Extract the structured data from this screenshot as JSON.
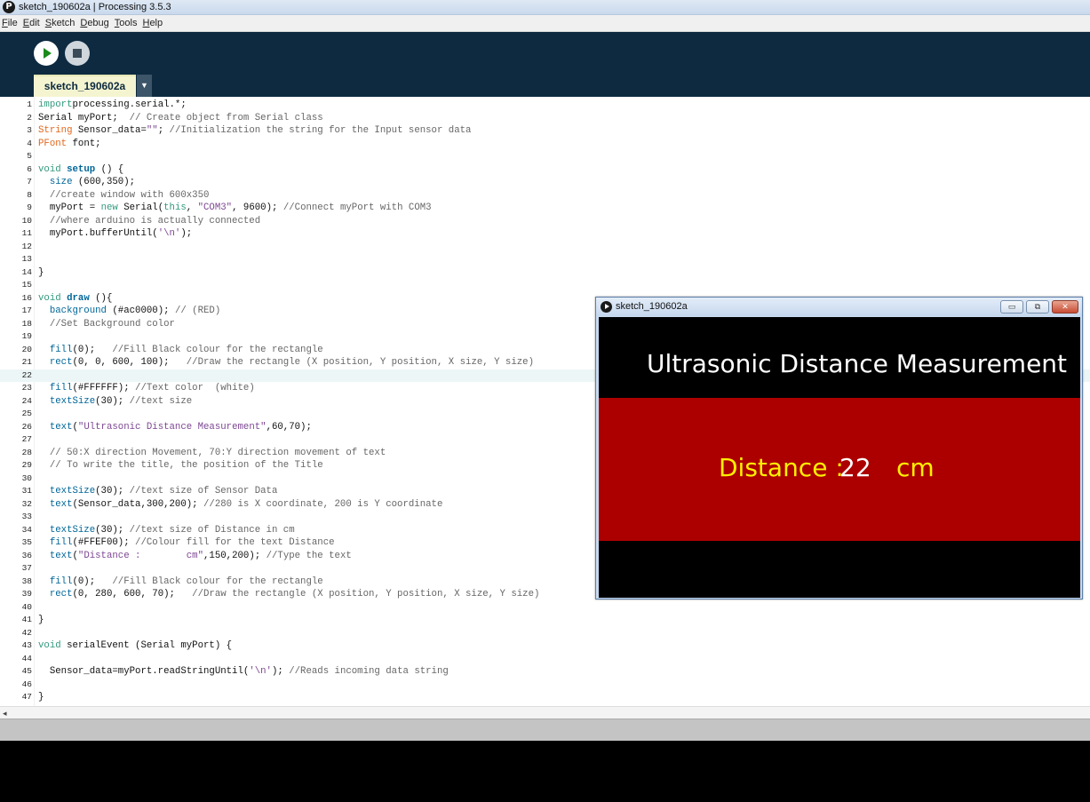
{
  "window": {
    "title": "sketch_190602a | Processing 3.5.3",
    "app_icon": "processing-logo-icon"
  },
  "menu": [
    {
      "mnemonic": "F",
      "rest": "ile"
    },
    {
      "mnemonic": "E",
      "rest": "dit"
    },
    {
      "mnemonic": "S",
      "rest": "ketch"
    },
    {
      "mnemonic": "D",
      "rest": "ebug"
    },
    {
      "mnemonic": "T",
      "rest": "ools"
    },
    {
      "mnemonic": "H",
      "rest": "elp"
    }
  ],
  "toolbar": {
    "run_icon": "play-icon",
    "stop_icon": "stop-icon"
  },
  "tabs": {
    "active": "sketch_190602a",
    "menu_glyph": "▼"
  },
  "editor": {
    "current_line": 22,
    "lines": [
      [
        [
          "kw",
          "import"
        ],
        [
          "",
          "processing.serial.*;"
        ]
      ],
      [
        [
          "",
          "Serial myPort;  "
        ],
        [
          "cm",
          "// Create object from Serial class"
        ]
      ],
      [
        [
          "ty",
          "String"
        ],
        [
          "",
          " Sensor_data="
        ],
        [
          "st",
          "\"\""
        ],
        [
          "",
          "; "
        ],
        [
          "cm",
          "//Initialization the string for the Input sensor data"
        ]
      ],
      [
        [
          "ty",
          "PFont"
        ],
        [
          "",
          " font;"
        ]
      ],
      [],
      [
        [
          "kw",
          "void"
        ],
        [
          "",
          " "
        ],
        [
          "fn",
          "setup"
        ],
        [
          "",
          " () {"
        ]
      ],
      [
        [
          "",
          "  "
        ],
        [
          "bi",
          "size"
        ],
        [
          "",
          " (600,350);"
        ]
      ],
      [
        [
          "",
          "  "
        ],
        [
          "cm",
          "//create window with 600x350"
        ]
      ],
      [
        [
          "",
          "  myPort = "
        ],
        [
          "kw",
          "new"
        ],
        [
          "",
          " Serial("
        ],
        [
          "kw",
          "this"
        ],
        [
          "",
          ", "
        ],
        [
          "st",
          "\"COM3\""
        ],
        [
          "",
          ", 9600); "
        ],
        [
          "cm",
          "//Connect myPort with COM3"
        ]
      ],
      [
        [
          "",
          "  "
        ],
        [
          "cm",
          "//where arduino is actually connected"
        ]
      ],
      [
        [
          "",
          "  myPort.bufferUntil("
        ],
        [
          "st",
          "'\\n'"
        ],
        [
          "",
          ");"
        ]
      ],
      [],
      [],
      [
        [
          "",
          "}"
        ]
      ],
      [],
      [
        [
          "kw",
          "void"
        ],
        [
          "",
          " "
        ],
        [
          "fn",
          "draw"
        ],
        [
          "",
          " (){"
        ]
      ],
      [
        [
          "",
          "  "
        ],
        [
          "bi",
          "background"
        ],
        [
          "",
          " (#ac0000); "
        ],
        [
          "cm",
          "// (RED)"
        ]
      ],
      [
        [
          "",
          "  "
        ],
        [
          "cm",
          "//Set Background color"
        ]
      ],
      [],
      [
        [
          "",
          "  "
        ],
        [
          "bi",
          "fill"
        ],
        [
          "",
          "(0);   "
        ],
        [
          "cm",
          "//Fill Black colour for the rectangle"
        ]
      ],
      [
        [
          "",
          "  "
        ],
        [
          "bi",
          "rect"
        ],
        [
          "",
          "(0, 0, 600, 100);   "
        ],
        [
          "cm",
          "//Draw the rectangle (X position, Y position, X size, Y size)"
        ]
      ],
      [],
      [
        [
          "",
          "  "
        ],
        [
          "bi",
          "fill"
        ],
        [
          "",
          "(#FFFFFF); "
        ],
        [
          "cm",
          "//Text color  (white)"
        ]
      ],
      [
        [
          "",
          "  "
        ],
        [
          "bi",
          "textSize"
        ],
        [
          "",
          "(30); "
        ],
        [
          "cm",
          "//text size"
        ]
      ],
      [],
      [
        [
          "",
          "  "
        ],
        [
          "bi",
          "text"
        ],
        [
          "",
          "("
        ],
        [
          "st",
          "\"Ultrasonic Distance Measurement\""
        ],
        [
          "",
          ",60,70);"
        ]
      ],
      [],
      [
        [
          "",
          "  "
        ],
        [
          "cm",
          "// 50:X direction Movement, 70:Y direction movement of text"
        ]
      ],
      [
        [
          "",
          "  "
        ],
        [
          "cm",
          "// To write the title, the position of the Title"
        ]
      ],
      [],
      [
        [
          "",
          "  "
        ],
        [
          "bi",
          "textSize"
        ],
        [
          "",
          "(30); "
        ],
        [
          "cm",
          "//text size of Sensor Data"
        ]
      ],
      [
        [
          "",
          "  "
        ],
        [
          "bi",
          "text"
        ],
        [
          "",
          "(Sensor_data,300,200); "
        ],
        [
          "cm",
          "//280 is X coordinate, 200 is Y coordinate"
        ]
      ],
      [],
      [
        [
          "",
          "  "
        ],
        [
          "bi",
          "textSize"
        ],
        [
          "",
          "(30); "
        ],
        [
          "cm",
          "//text size of Distance in cm"
        ]
      ],
      [
        [
          "",
          "  "
        ],
        [
          "bi",
          "fill"
        ],
        [
          "",
          "(#FFEF00); "
        ],
        [
          "cm",
          "//Colour fill for the text Distance"
        ]
      ],
      [
        [
          "",
          "  "
        ],
        [
          "bi",
          "text"
        ],
        [
          "",
          "("
        ],
        [
          "st",
          "\"Distance :        cm\""
        ],
        [
          "",
          ",150,200); "
        ],
        [
          "cm",
          "//Type the text"
        ]
      ],
      [],
      [
        [
          "",
          "  "
        ],
        [
          "bi",
          "fill"
        ],
        [
          "",
          "(0);   "
        ],
        [
          "cm",
          "//Fill Black colour for the rectangle"
        ]
      ],
      [
        [
          "",
          "  "
        ],
        [
          "bi",
          "rect"
        ],
        [
          "",
          "(0, 280, 600, 70);   "
        ],
        [
          "cm",
          "//Draw the rectangle (X position, Y position, X size, Y size)"
        ]
      ],
      [],
      [
        [
          "",
          "}"
        ]
      ],
      [],
      [
        [
          "kw",
          "void"
        ],
        [
          "",
          " serialEvent (Serial myPort) {"
        ]
      ],
      [],
      [
        [
          "",
          "  Sensor_data=myPort.readStringUntil("
        ],
        [
          "st",
          "'\\n'"
        ],
        [
          "",
          "); "
        ],
        [
          "cm",
          "//Reads incoming data string"
        ]
      ],
      [],
      [
        [
          "",
          "}"
        ]
      ]
    ]
  },
  "scrollbar": {
    "left_arrow": "◂"
  },
  "sketch_window": {
    "title": "sketch_190602a",
    "minimize_glyph": "▭",
    "maximize_glyph": "⧉",
    "close_glyph": "✕",
    "canvas": {
      "title_text": "Ultrasonic Distance Measurement",
      "distance_label": "Distance :",
      "distance_value": "22",
      "unit": "cm",
      "colors": {
        "background": "#ac0000",
        "bar": "#000000",
        "label": "#ffef00",
        "value": "#ffffff"
      }
    }
  },
  "colors": {
    "toolbar": "#0d2a40",
    "tab_active": "#f4f4d0",
    "keyword": "#33997e",
    "type": "#e2661a",
    "function": "#006699",
    "string": "#7d4793",
    "comment": "#666666"
  }
}
